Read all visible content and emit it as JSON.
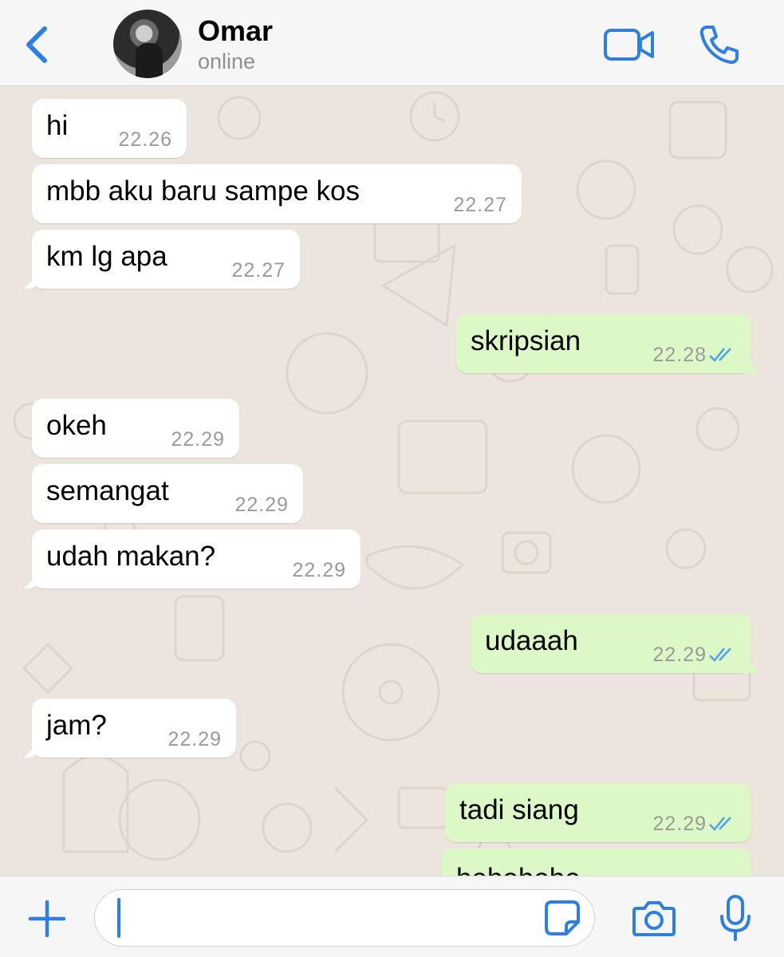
{
  "header": {
    "contact_name": "Omar",
    "contact_status": "online",
    "back_icon": "chevron-left-icon",
    "video_icon": "video-camera-icon",
    "call_icon": "phone-icon"
  },
  "colors": {
    "accent": "#2f7fe0",
    "incoming_bubble": "#ffffff",
    "outgoing_bubble": "#dcf8c6",
    "read_ticks": "#4fa3e6",
    "wallpaper": "#ece5dd"
  },
  "messages": [
    {
      "direction": "in",
      "text": "hi",
      "time": "22.26"
    },
    {
      "direction": "in",
      "text": "mbb aku baru sampe kos",
      "time": "22.27"
    },
    {
      "direction": "in",
      "text": "km lg apa",
      "time": "22.27"
    },
    {
      "direction": "out",
      "text": "skripsian",
      "time": "22.28",
      "status": "read"
    },
    {
      "direction": "in",
      "text": "okeh",
      "time": "22.29"
    },
    {
      "direction": "in",
      "text": "semangat",
      "time": "22.29"
    },
    {
      "direction": "in",
      "text": "udah makan?",
      "time": "22.29"
    },
    {
      "direction": "out",
      "text": "udaaah",
      "time": "22.29",
      "status": "read"
    },
    {
      "direction": "in",
      "text": "jam?",
      "time": "22.29"
    },
    {
      "direction": "out",
      "text": "tadi siang",
      "time": "22.29",
      "status": "read"
    },
    {
      "direction": "out",
      "text": "hehehehe",
      "time": "",
      "status": "partially-visible"
    }
  ],
  "composer": {
    "input_value": "",
    "plus_icon": "plus-icon",
    "sticker_icon": "sticker-icon",
    "camera_icon": "camera-icon",
    "mic_icon": "microphone-icon"
  }
}
